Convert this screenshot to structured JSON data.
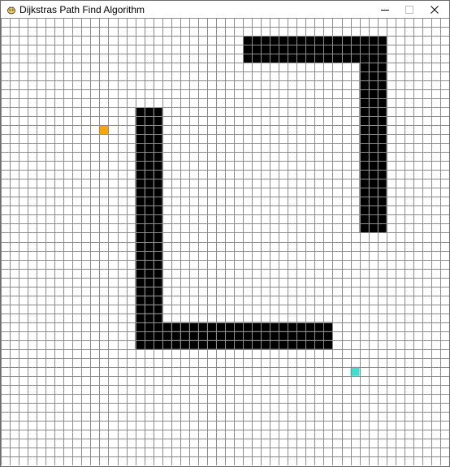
{
  "window": {
    "title": "Dijkstras Path Find Algorithm",
    "controls": [
      "minimize",
      "maximize",
      "close"
    ]
  },
  "grid": {
    "columns": 50,
    "rows": 50,
    "colors": {
      "background": "#ffffff",
      "grid_line": "#8c8c8c",
      "barrier": "#000000",
      "start": "#ffa500",
      "end": "#40e0d0"
    },
    "start_node": {
      "col": 11,
      "row": 12
    },
    "end_node": {
      "col": 39,
      "row": 39
    },
    "barriers": [
      {
        "col_start": 27,
        "col_end": 42,
        "row_start": 2,
        "row_end": 4
      },
      {
        "col_start": 40,
        "col_end": 42,
        "row_start": 2,
        "row_end": 23
      },
      {
        "col_start": 15,
        "col_end": 17,
        "row_start": 10,
        "row_end": 36
      },
      {
        "col_start": 15,
        "col_end": 36,
        "row_start": 34,
        "row_end": 36
      }
    ]
  }
}
